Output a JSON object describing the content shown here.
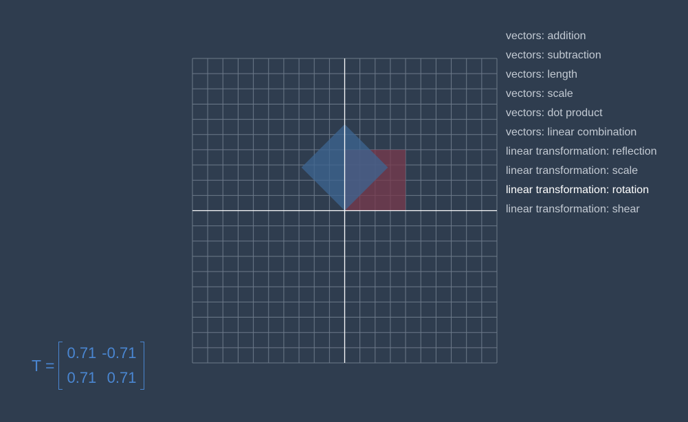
{
  "menu": {
    "items": [
      {
        "label": "vectors: addition",
        "active": false
      },
      {
        "label": "vectors: subtraction",
        "active": false
      },
      {
        "label": "vectors: length",
        "active": false
      },
      {
        "label": "vectors: scale",
        "active": false
      },
      {
        "label": "vectors: dot product",
        "active": false
      },
      {
        "label": "vectors: linear combination",
        "active": false
      },
      {
        "label": "linear transformation: reflection",
        "active": false
      },
      {
        "label": "linear transformation: scale",
        "active": false
      },
      {
        "label": "linear transformation: rotation",
        "active": true
      },
      {
        "label": "linear transformation: shear",
        "active": false
      }
    ]
  },
  "matrix": {
    "label": "T =",
    "a": "0.71",
    "b": "-0.71",
    "c": "0.71",
    "d": "0.71"
  },
  "plane": {
    "grid_range": [
      -10,
      10
    ],
    "original_square": {
      "x": [
        0,
        4
      ],
      "y": [
        0,
        4
      ]
    },
    "rotation_degrees": 45
  },
  "colors": {
    "background": "#2f3d4f",
    "grid_line": "#6d7a8a",
    "axis": "#ffffff",
    "original_square": "#7a3a4c",
    "transformed_square": "#3d6592",
    "matrix_text": "#4a86d1",
    "menu_text": "#c3cad3",
    "menu_active": "#ffffff"
  }
}
